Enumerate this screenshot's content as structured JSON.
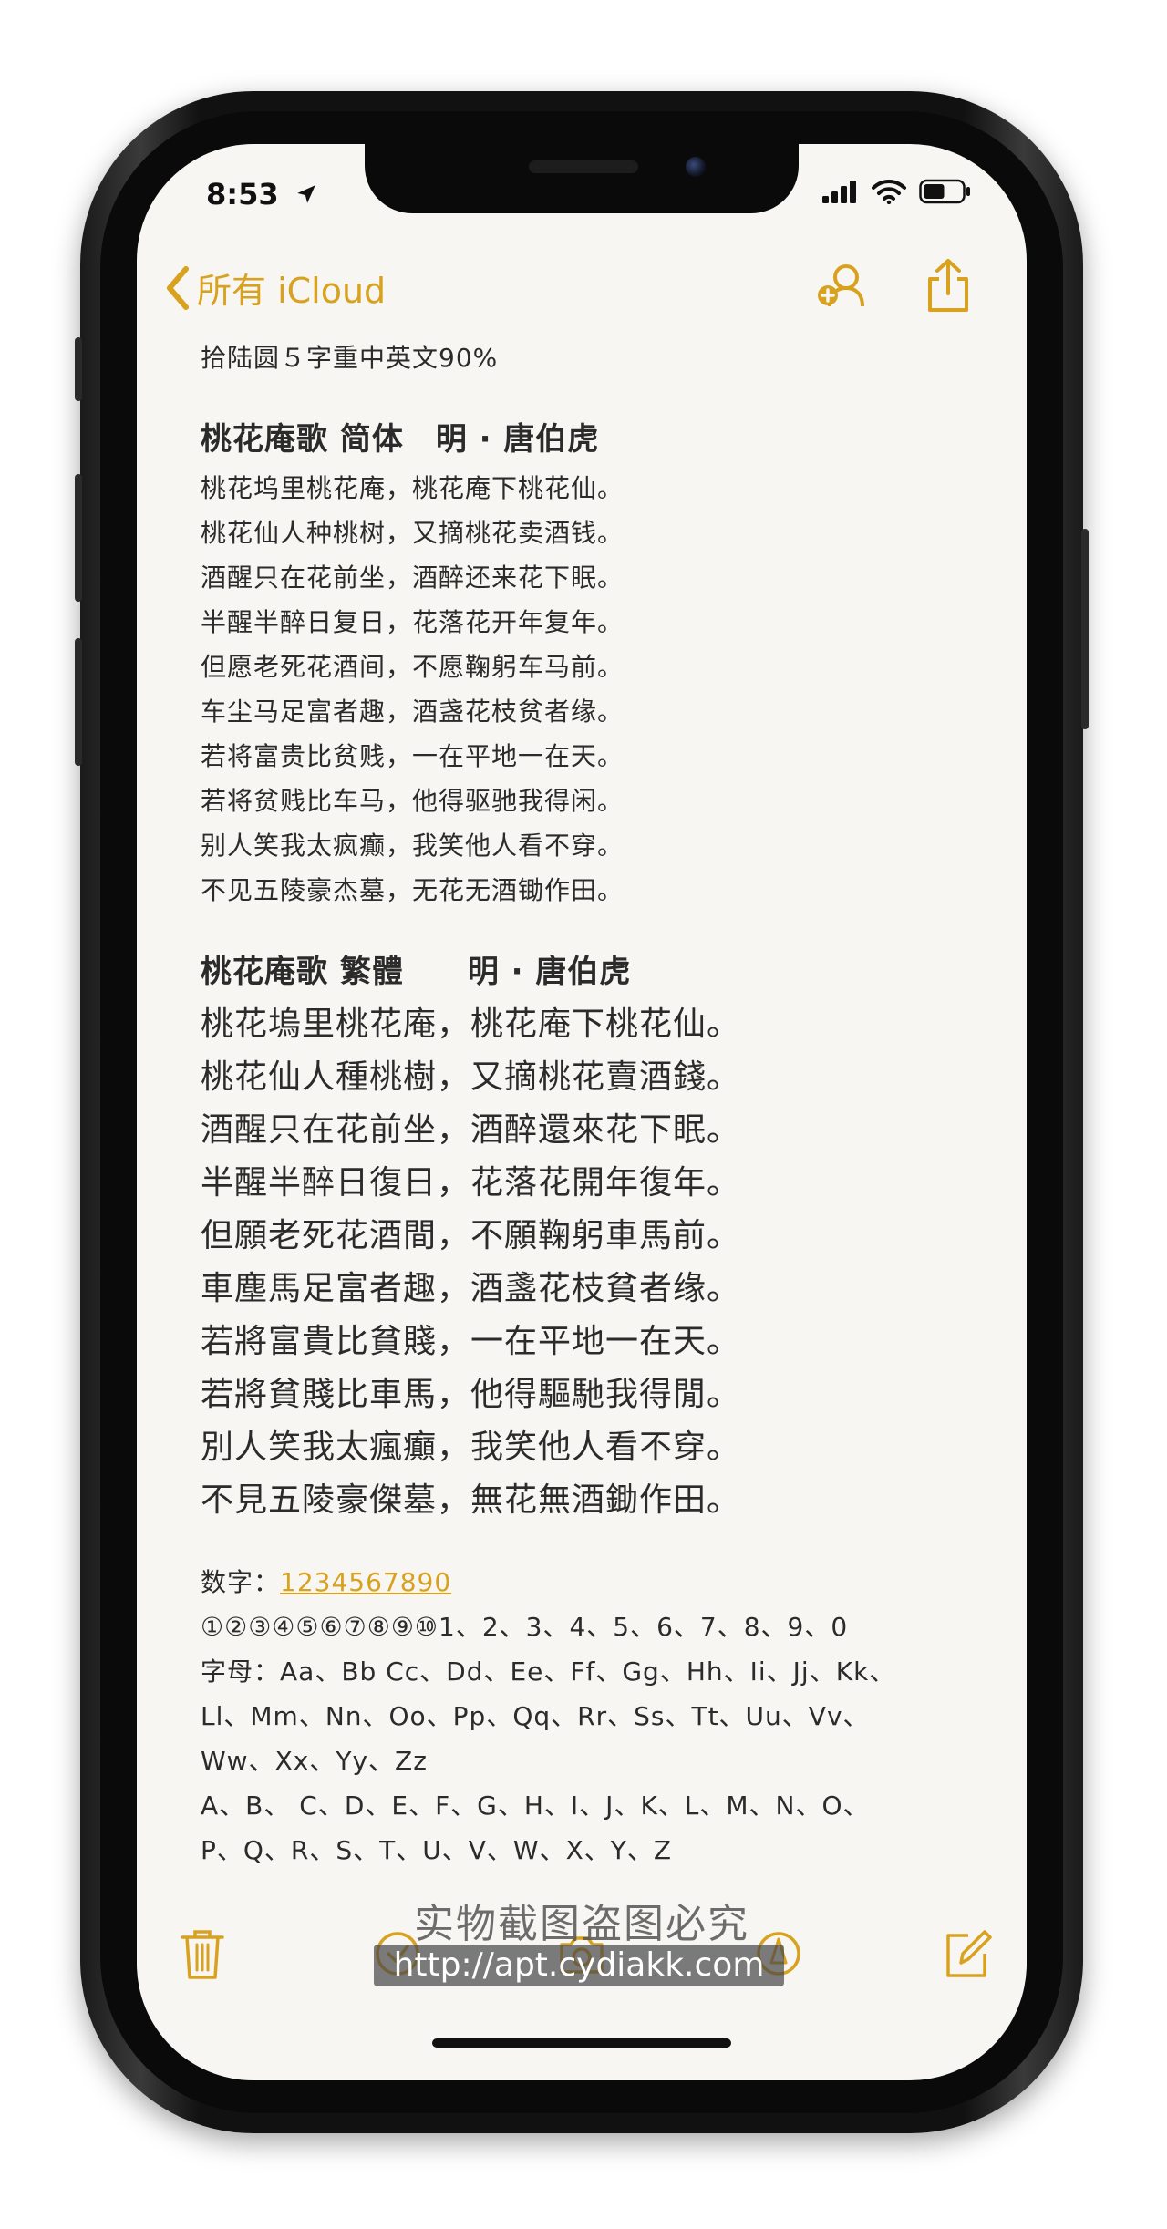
{
  "status_bar": {
    "time": "8:53"
  },
  "nav": {
    "back_label": "所有 iCloud"
  },
  "note": {
    "header_line": "拾陆圆５字重中英文90%",
    "simplified": {
      "title": "桃花庵歌 简体　明 · 唐伯虎",
      "lines": [
        "桃花坞里桃花庵，桃花庵下桃花仙。",
        "桃花仙人种桃树，又摘桃花卖酒钱。",
        "酒醒只在花前坐，酒醉还来花下眠。",
        "半醒半醉日复日，花落花开年复年。",
        "但愿老死花酒间，不愿鞠躬车马前。",
        "车尘马足富者趣，酒盏花枝贫者缘。",
        "若将富贵比贫贱，一在平地一在天。",
        "若将贫贱比车马，他得驱驰我得闲。",
        "别人笑我太疯癫，我笑他人看不穿。",
        "不见五陵豪杰墓，无花无酒锄作田。"
      ]
    },
    "traditional": {
      "title": "桃花庵歌 繁體　　明 · 唐伯虎",
      "lines": [
        "桃花塢里桃花庵，桃花庵下桃花仙。",
        "桃花仙人種桃樹，又摘桃花賣酒錢。",
        "酒醒只在花前坐，酒醉還來花下眠。",
        "半醒半醉日復日，花落花開年復年。",
        "但願老死花酒間，不願鞠躬車馬前。",
        "車塵馬足富者趣，酒盞花枝貧者缘。",
        "若將富貴比貧賤，一在平地一在天。",
        "若將貧賤比車馬，他得驅馳我得閒。",
        "別人笑我太瘋癲，我笑他人看不穿。",
        "不見五陵豪傑墓，無花無酒鋤作田。"
      ]
    },
    "numbers_label": "数字：",
    "numbers_link": "1234567890",
    "circled_line": "①②③④⑤⑥⑦⑧⑨⑩1、2、3、4、5、6、7、8、9、0",
    "letters_lines": [
      "字母：Aa、Bb Cc、Dd、Ee、Ff、Gg、Hh、Ii、Jj、Kk、",
      "Ll、Mm、Nn、Oo、Pp、Qq、Rr、Ss、Tt、Uu、Vv、",
      "Ww、Xx、Yy、Zz",
      "A、B、 C、D、E、F、G、H、I、J、K、L、M、N、O、",
      "P、Q、R、S、T、U、V、W、X、Y、Z"
    ]
  },
  "watermark": {
    "text": "实物截图盗图必究",
    "url": "http://apt.cydiakk.com"
  },
  "colors": {
    "accent": "#d8a21f",
    "text": "#2b2b2b",
    "paper": "#f7f6f3"
  }
}
